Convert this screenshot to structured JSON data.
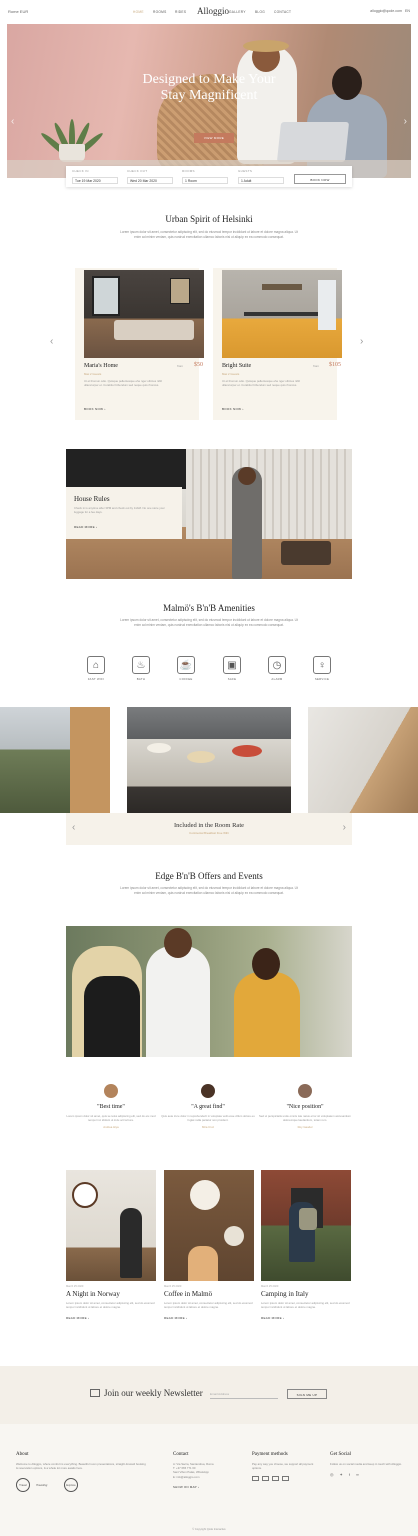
{
  "header": {
    "left": "Rome  EUR",
    "logo": "Alloggio",
    "nav": [
      "HOME",
      "ROOMS",
      "RIDES",
      "GALLERY",
      "BLOG",
      "CONTACT"
    ],
    "right_email": "alloggio@qode.com",
    "right_lang": "EN"
  },
  "hero": {
    "title_line1": "Designed to Make Your",
    "title_line2": "Stay Magnificent",
    "cta": "VIEW MORE"
  },
  "booking": {
    "checkin_label": "CHECK IN",
    "checkin_value": "Tue 19 Mar 2020",
    "checkout_label": "CHECK OUT",
    "checkout_value": "Wed 20 Mar 2020",
    "rooms_label": "ROOMS",
    "rooms_value": "1 Room",
    "guests_label": "GUESTS",
    "guests_value": "1 Adult",
    "button": "BOOK NOW"
  },
  "intro": {
    "title": "Urban Spirit of Helsinki",
    "text": "Lorem ipsum dolor sit amet, consectetur adipiscing elit, sed do eiusmod tempor incididunt ut labore et dolore magna aliqua. Ut enim ad minim veniam, quis nostrud exercitation ullamco laboris nisi ut aliquip ex ea commodo consequat."
  },
  "rooms": [
    {
      "name": "Maria's Home",
      "from": "from",
      "price": "$50",
      "meta": "Max 2 Guests",
      "desc": "Ut et thomun odio. Quisque pellentesque ehe nger ultrices nibh ullamcorper et. Curabitur bibendum sed neque quis rhoncus.",
      "book": "BOOK NOW"
    },
    {
      "name": "Bright Suite",
      "from": "from",
      "price": "$105",
      "meta": "Max 2 Guests",
      "desc": "Ut et thomun odio. Quisque pellentesque ehe nger ultrices nibh ullamcorper et. Curabitur bibendum sed neque quis rhoncus.",
      "book": "BOOK NOW"
    }
  ],
  "rules": {
    "title": "House Rules",
    "text": "Check in is anytime after 3PM and check out by 11AM. No one store your luggage for a fee days.",
    "link": "READ MORE"
  },
  "amenities": {
    "title": "Malmö's B'n'B Amenities",
    "text": "Lorem ipsum dolor sit amet, consectetur adipiscing elit, sed do eiusmod tempor incididunt ut labore et dolore magna aliqua. Ut enim ad minim veniam, quis nostrud exercitation ullamco laboris nisi ut aliquip ex ea commodo consequat.",
    "items": [
      {
        "label": "FAST WIFI",
        "icon": "wifi-icon",
        "glyph": "⌂"
      },
      {
        "label": "BATH",
        "icon": "bath-icon",
        "glyph": "♨"
      },
      {
        "label": "COFFEE",
        "icon": "coffee-icon",
        "glyph": "☕"
      },
      {
        "label": "SAFE",
        "icon": "safe-icon",
        "glyph": "▣"
      },
      {
        "label": "ALARM",
        "icon": "alarm-icon",
        "glyph": "◷"
      },
      {
        "label": "SERVICE",
        "icon": "service-bell-icon",
        "glyph": "♀"
      }
    ]
  },
  "included": {
    "title": "Included in the Room Rate",
    "sub": "Continental Breakfast Free WiFi"
  },
  "events": {
    "title": "Edge B'n'B Offers and Events",
    "text": "Lorem ipsum dolor sit amet, consectetur adipiscing elit, sed do eiusmod tempor incididunt ut labore et dolore magna aliqua. Ut enim ad minim veniam, quis nostrud exercitation ullamco laboris nisi ut aliquip ex ea commodo consequat."
  },
  "testimonials": [
    {
      "quote": "\"Best time\"",
      "text": "Lorem ipsum dolor sit amet, quis se telus adipiscing elit, sed do eiu mod tempor inc ididunt ut indu uct la bure.",
      "name": "Andrea Hiya"
    },
    {
      "quote": "\"A great find\"",
      "text": "Quis aute irure dolor in reprehenderit in voluptate velit esse cillum dolore eu fugiat nulla pariatur non proident.",
      "name": "Mira Cruz"
    },
    {
      "quote": "\"Nice position\"",
      "text": "Sed ut perspiciatis unde omnis iste natus error sit voluptatem accusantium doloremque laudantium, totam rem.",
      "name": "Roy Gaudel"
    }
  ],
  "posts": [
    {
      "date": "March 25 2020",
      "title": "A Night in Norway",
      "text": "Lorem ipsum dolor sit amet, consectetur adipiscing elit, sed do eiusmod tempor incididunt ut labore et dolore magna.",
      "link": "READ MORE"
    },
    {
      "date": "March 25 2020",
      "title": "Coffee in Malmö",
      "text": "Lorem ipsum dolor sit amet, consectetur adipiscing elit, sed do eiusmod tempor incididunt ut labore et dolore magna.",
      "link": "READ MORE"
    },
    {
      "date": "March 25 2020",
      "title": "Camping in Italy",
      "text": "Lorem ipsum dolor sit amet, consectetur adipiscing elit, sed do eiusmod tempor incididunt ut labore et dolore magna.",
      "link": "READ MORE"
    }
  ],
  "newsletter": {
    "title": "Join our weekly Newsletter",
    "placeholder": "Email Address",
    "button": "SIGN ME UP"
  },
  "footer": {
    "about_h": "About",
    "about_t": "Welcome to Alloggio, where comfort is everything. Beautiful room presentations, straight-forward booking & reservation options, & a whole lot more awaits here.",
    "badges": [
      "Travel",
      "Traveling",
      "Explore"
    ],
    "contact_h": "Contact",
    "contact_lines": [
      "A: Via Sacra, Santandrea, Roma",
      "T: +37 665 771 60",
      "Sant Vibon Palas, WhatsApp",
      "E: info@alloggio.com"
    ],
    "contact_link": "SHOW ON MAP",
    "payment_h": "Payment methods",
    "payment_t": "Pay any way you choose, we support all payment options.",
    "social_h": "Get Social",
    "social_t": "Follow us on social media and keep in touch with Alloggio.",
    "copyright": "© Copyright Qode Interactive"
  }
}
